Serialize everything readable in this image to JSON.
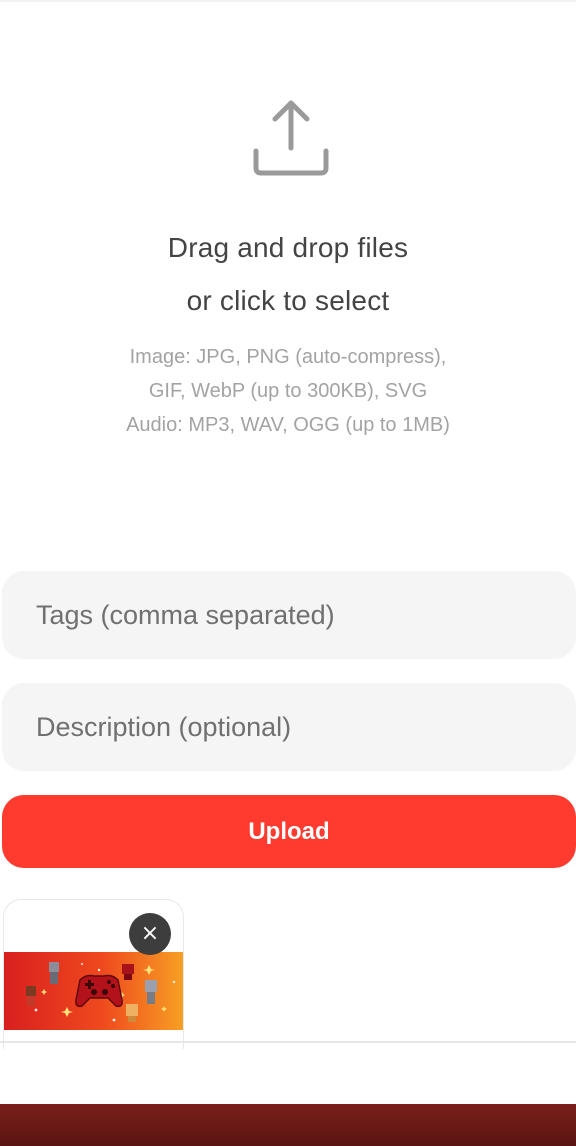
{
  "dropzone": {
    "icon": "upload-icon",
    "title_line1": "Drag and drop files",
    "title_line2": "or click to select",
    "hint_line1": "Image: JPG, PNG (auto-compress),",
    "hint_line2": "GIF, WebP (up to 300KB), SVG",
    "hint_line3": "Audio: MP3, WAV, OGG (up to 1MB)"
  },
  "form": {
    "tags_placeholder": "Tags (comma separated)",
    "tags_value": "",
    "description_placeholder": "Description (optional)",
    "description_value": "",
    "upload_label": "Upload",
    "accent_color": "#ff3b30"
  },
  "preview": {
    "items": [
      {
        "thumbnail": "game-controller-thumbnail",
        "remove_label": "×"
      }
    ]
  }
}
